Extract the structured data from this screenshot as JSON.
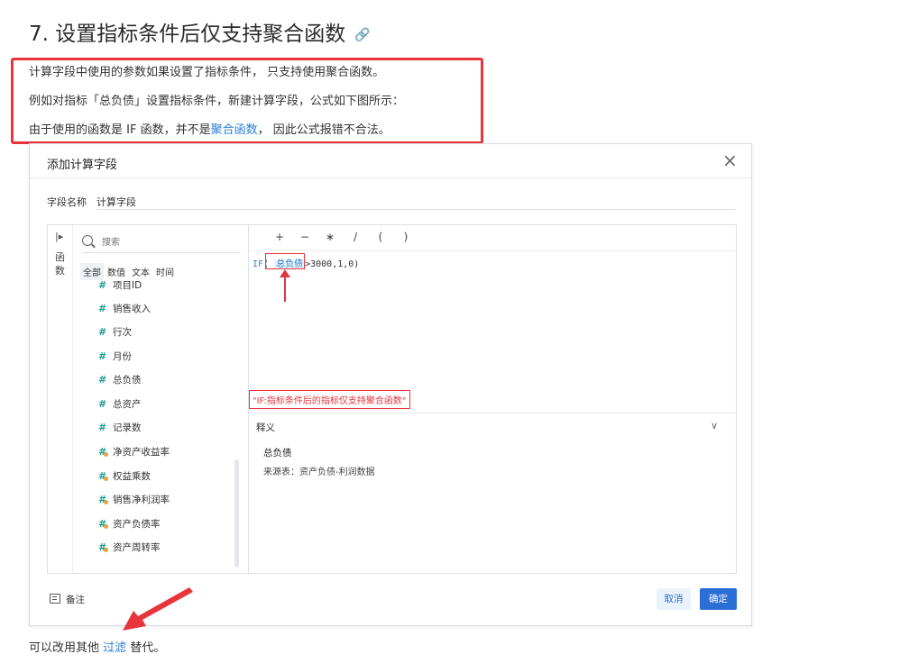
{
  "doc": {
    "heading": "7. 设置指标条件后仅支持聚合函数",
    "para1": "计算字段中使用的参数如果设置了指标条件， 只支持使用聚合函数。",
    "para2": "例如对指标「总负债」设置指标条件，新建计算字段，公式如下图所示：",
    "para3_prefix": "由于使用的函数是 IF 函数，并不是",
    "para3_link": "聚合函数",
    "para3_suffix": "， 因此公式报错不合法。",
    "footer_prefix": "可以改用其他 ",
    "footer_link": "过滤",
    "footer_suffix": " 替代。"
  },
  "dialog": {
    "title": "添加计算字段",
    "close": "×",
    "field_name_label": "字段名称",
    "field_name_value": "计算字段",
    "rail_label": "函数",
    "search_placeholder": "搜索",
    "tabs": [
      "全部",
      "数值",
      "文本",
      "时间"
    ],
    "fields": [
      {
        "name": "项目ID",
        "kind": "number"
      },
      {
        "name": "销售收入",
        "kind": "number"
      },
      {
        "name": "行次",
        "kind": "number"
      },
      {
        "name": "月份",
        "kind": "number"
      },
      {
        "name": "总负债",
        "kind": "number"
      },
      {
        "name": "总资产",
        "kind": "number"
      },
      {
        "name": "记录数",
        "kind": "number"
      },
      {
        "name": "净资产收益率",
        "kind": "calc"
      },
      {
        "name": "权益乘数",
        "kind": "calc"
      },
      {
        "name": "销售净利润率",
        "kind": "calc"
      },
      {
        "name": "资产负债率",
        "kind": "calc"
      },
      {
        "name": "资产周转率",
        "kind": "calc"
      }
    ],
    "operators": [
      "+",
      "−",
      "∗",
      "/",
      "(",
      ")"
    ],
    "formula": {
      "fn": "IF",
      "token": "总负债",
      "rest": ">3000,1,0)"
    },
    "error_message": "\"IF:指标条件后的指标仅支持聚合函数\"",
    "explain_title": "释义",
    "explain_name": "总负债",
    "explain_source": "来源表：资产负债-利润数据",
    "note_label": "备注",
    "cancel_label": "取消",
    "ok_label": "确定"
  },
  "colors": {
    "accent": "#2b6fd6",
    "error": "#e8343b",
    "link": "#2a7fd4"
  }
}
